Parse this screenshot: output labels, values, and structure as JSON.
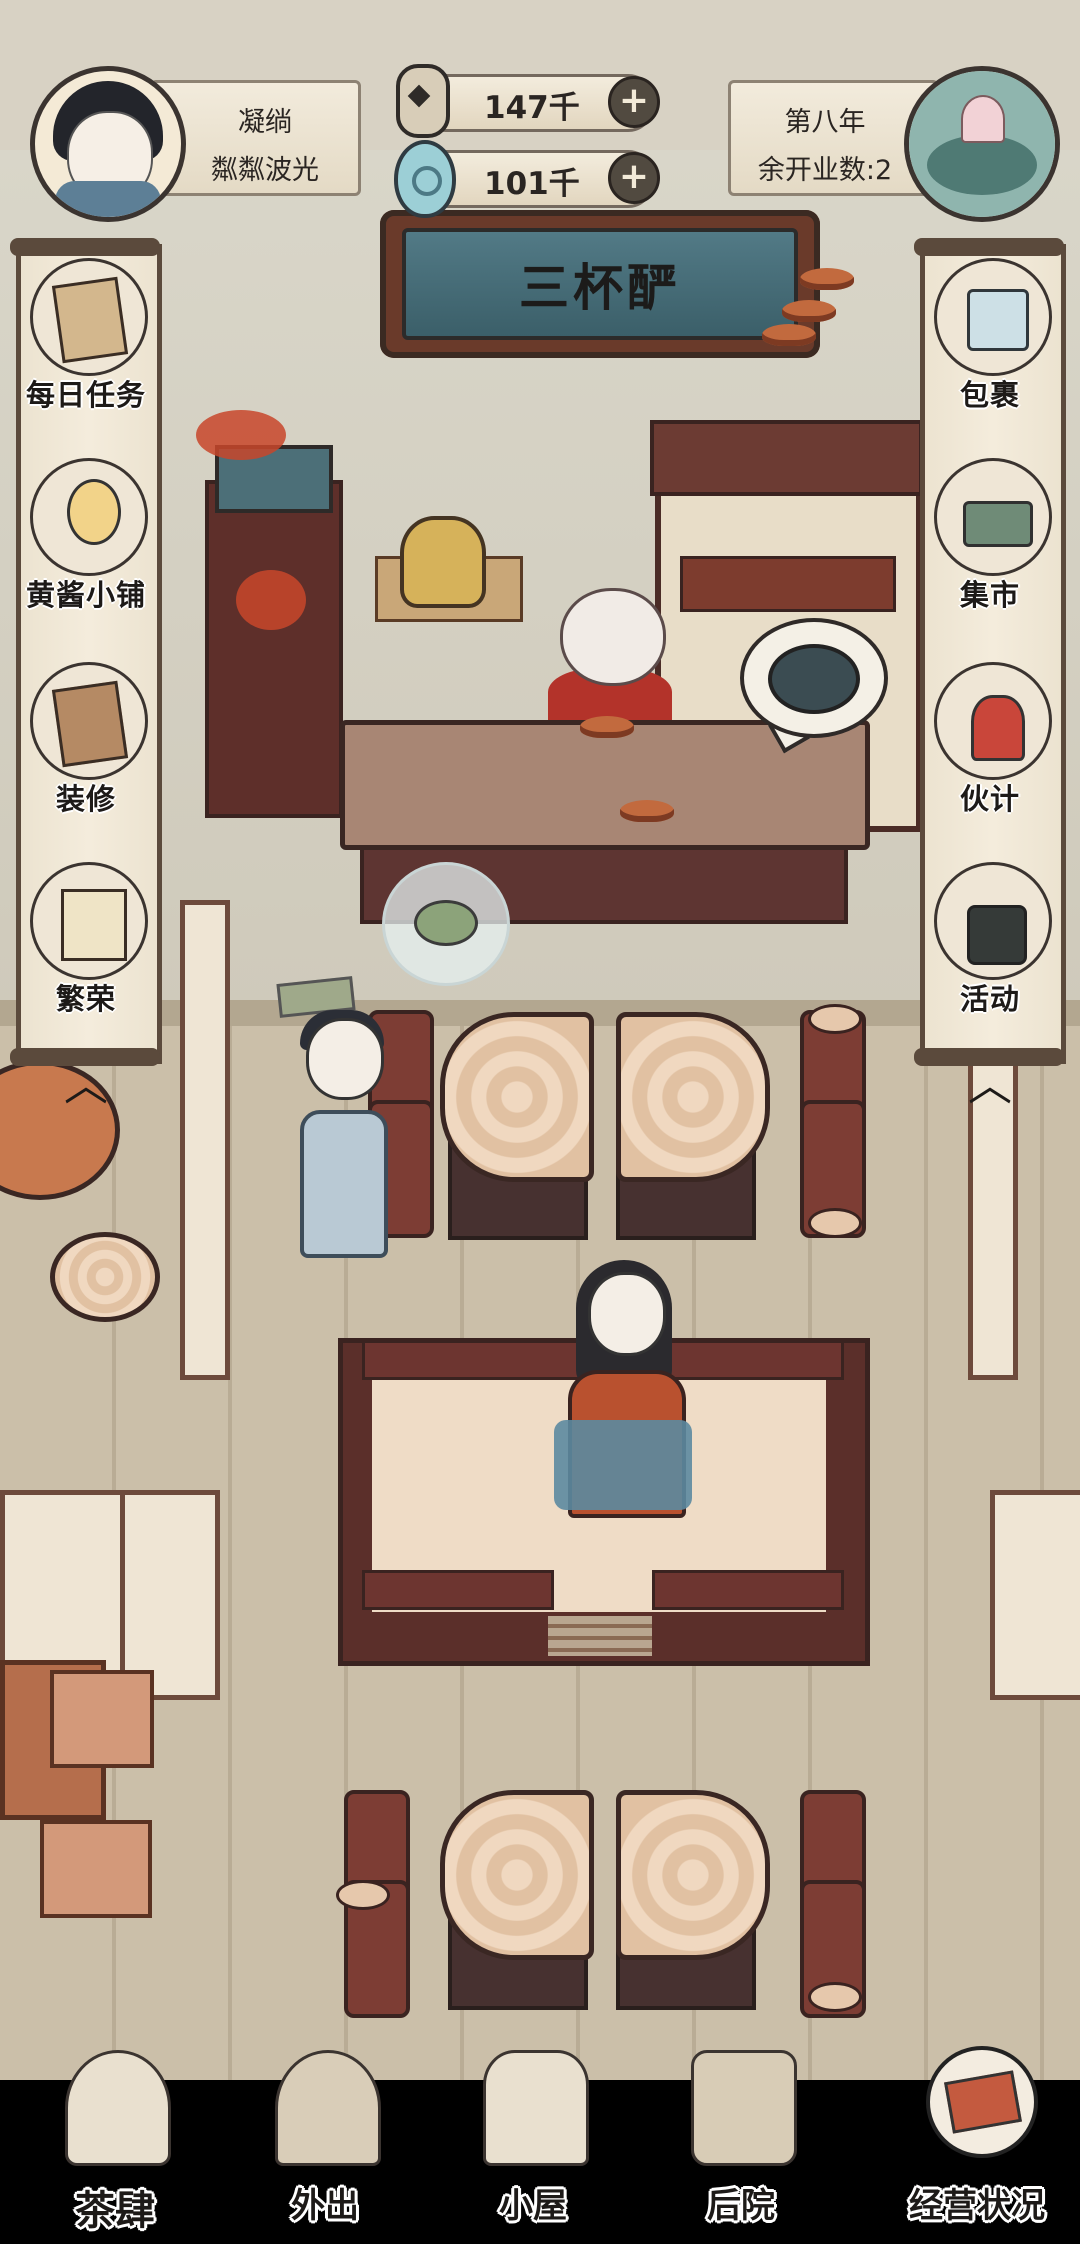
{
  "player": {
    "name": "凝绱",
    "title": "粼粼波光"
  },
  "currency": {
    "coins": {
      "icon": "copper-coin-icon",
      "value": "147千"
    },
    "jade": {
      "icon": "jade-drop-icon",
      "value": "101千"
    }
  },
  "year": {
    "label": "第八年",
    "remaining": "余开业数:2"
  },
  "shop": {
    "name": "三杯酽"
  },
  "left_menu": [
    {
      "label": "每日任务",
      "icon": "task-scroll-icon"
    },
    {
      "label": "黄酱小铺",
      "icon": "girl-shopkeeper-icon"
    },
    {
      "label": "装修",
      "icon": "furniture-icon"
    },
    {
      "label": "繁荣",
      "icon": "lantern-icon"
    }
  ],
  "right_menu": [
    {
      "label": "包裹",
      "icon": "bundle-icon"
    },
    {
      "label": "集市",
      "icon": "market-stall-icon"
    },
    {
      "label": "伙计",
      "icon": "helper-icon"
    },
    {
      "label": "活动",
      "icon": "event-banner-icon"
    }
  ],
  "bottom_nav": [
    {
      "label": "茶肆",
      "icon": "teahouse-icon",
      "active": true
    },
    {
      "label": "外出",
      "icon": "mountain-icon",
      "active": false
    },
    {
      "label": "小屋",
      "icon": "cottage-icon",
      "active": false
    },
    {
      "label": "后院",
      "icon": "backyard-icon",
      "active": false
    },
    {
      "label": "经营状况",
      "icon": "ledger-icon",
      "active": false
    }
  ],
  "colors": {
    "accent_red": "#c8462a",
    "ink": "#1d1a18",
    "paper": "#efe6d6",
    "sign_teal": "#527a86"
  }
}
